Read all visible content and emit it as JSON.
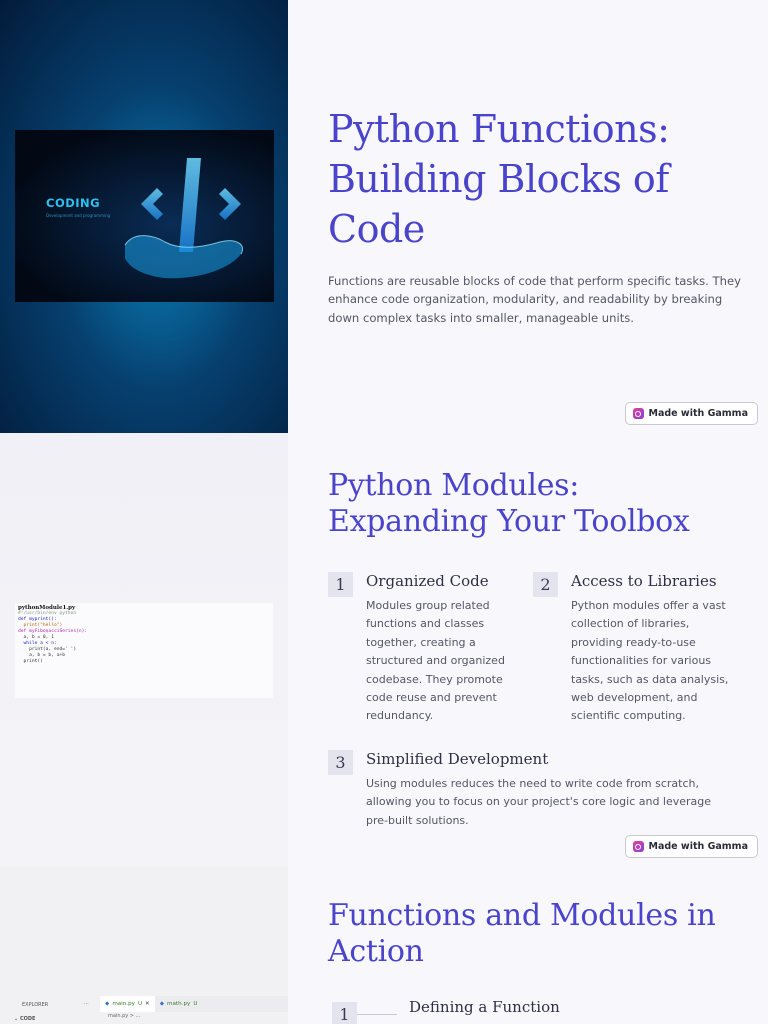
{
  "slide1": {
    "title": "Python Functions: Building Blocks of Code",
    "lead": "Functions are reusable blocks of code that perform specific tasks. They enhance code organization, modularity, and readability by breaking down complex tasks into smaller, manageable units.",
    "image": {
      "word": "CODING",
      "subtitle": "Development and programming"
    },
    "gamma_label": "Made with Gamma"
  },
  "slide2": {
    "title": "Python Modules: Expanding Your Toolbox",
    "items": [
      {
        "num": "1",
        "title": "Organized Code",
        "text": "Modules group related functions and classes together, creating a structured and organized codebase. They promote code reuse and prevent redundancy."
      },
      {
        "num": "2",
        "title": "Access to Libraries",
        "text": "Python modules offer a vast collection of libraries, providing ready-to-use functionalities for various tasks, such as data analysis, web development, and scientific computing."
      },
      {
        "num": "3",
        "title": "Simplified Development",
        "text": "Using modules reduces the need to write code from scratch, allowing you to focus on your project's core logic and leverage pre-built solutions."
      }
    ],
    "snippet": {
      "filename": "pythonModule1.py",
      "lines": [
        "#!/usr/bin/env python",
        "",
        "def myprint():",
        "  print(\"hello\")",
        "",
        "",
        "def myFibonacciSeries(n):",
        "  a, b = 0, 1",
        "  while a < n:",
        "    print(a, end=' ')",
        "    a, b = b, a+b",
        "  print()"
      ]
    },
    "gamma_label": "Made with Gamma"
  },
  "slide3": {
    "title": "Functions and Modules in Action",
    "timeline": [
      {
        "num": "1",
        "title": "Defining a Function"
      }
    ],
    "editor": {
      "explorer": "EXPLORER",
      "folder": "CODE",
      "tabs": [
        {
          "label": "main.py",
          "status": "U",
          "active": true
        },
        {
          "label": "math.py",
          "status": "U",
          "active": false
        }
      ],
      "crumb": "main.py > ..."
    }
  },
  "colors": {
    "heading": "#4a44cc",
    "body_text": "#555566",
    "badge_bg": "#e4e4ee"
  }
}
